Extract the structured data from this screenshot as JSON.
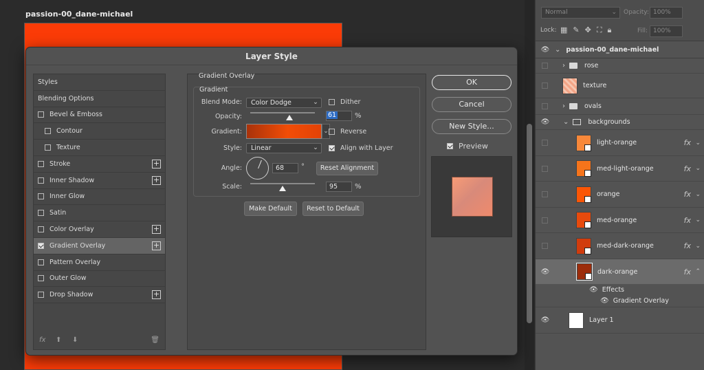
{
  "document": {
    "title": "passion-00_dane-michael",
    "canvas_color": "#fb3b07"
  },
  "layers_panel": {
    "blend_mode": "Normal",
    "opacity_label": "Opacity:",
    "opacity_value": "100%",
    "lock_label": "Lock:",
    "fill_label": "Fill:",
    "fill_value": "100%",
    "group_name": "passion-00_dane-michael",
    "items": [
      {
        "name": "rose",
        "type": "folder"
      },
      {
        "name": "texture",
        "type": "layer"
      },
      {
        "name": "ovals",
        "type": "folder"
      },
      {
        "name": "backgrounds",
        "type": "folder"
      },
      {
        "name": "light-orange",
        "color": "#f8883a"
      },
      {
        "name": "med-light-orange",
        "color": "#f6741b"
      },
      {
        "name": "orange",
        "color": "#fb5606"
      },
      {
        "name": "med-orange",
        "color": "#e84a0c"
      },
      {
        "name": "med-dark-orange",
        "color": "#d13c0d"
      },
      {
        "name": "dark-orange",
        "color": "#9c2c0b"
      },
      {
        "name": "Layer 1",
        "color": "#ffffff"
      }
    ],
    "effects_label": "Effects",
    "effect_item": "Gradient Overlay",
    "fx_label": "fx"
  },
  "dialog": {
    "title": "Layer Style",
    "styles": [
      {
        "label": "Styles"
      },
      {
        "label": "Blending Options"
      },
      {
        "label": "Bevel & Emboss",
        "checkbox": true
      },
      {
        "label": "Contour",
        "checkbox": true,
        "indent": true
      },
      {
        "label": "Texture",
        "checkbox": true,
        "indent": true
      },
      {
        "label": "Stroke",
        "checkbox": true,
        "plus": true
      },
      {
        "label": "Inner Shadow",
        "checkbox": true,
        "plus": true
      },
      {
        "label": "Inner Glow",
        "checkbox": true
      },
      {
        "label": "Satin",
        "checkbox": true
      },
      {
        "label": "Color Overlay",
        "checkbox": true,
        "plus": true
      },
      {
        "label": "Gradient Overlay",
        "checkbox": true,
        "checked": true,
        "plus": true,
        "selected": true
      },
      {
        "label": "Pattern Overlay",
        "checkbox": true
      },
      {
        "label": "Outer Glow",
        "checkbox": true
      },
      {
        "label": "Drop Shadow",
        "checkbox": true,
        "plus": true
      }
    ],
    "bottom": {
      "fx": "fx",
      "up": "⬆",
      "down": "⬇",
      "trash": "🗑"
    },
    "section_title": "Gradient Overlay",
    "group_title": "Gradient",
    "blend_mode_label": "Blend Mode:",
    "blend_mode_value": "Color Dodge",
    "dither_label": "Dither",
    "opacity_label": "Opacity:",
    "opacity_value": "61",
    "opacity_unit": "%",
    "opacity_fraction": 0.61,
    "gradient_label": "Gradient:",
    "reverse_label": "Reverse",
    "style_label": "Style:",
    "style_value": "Linear",
    "align_label": "Align with Layer",
    "angle_label": "Angle:",
    "angle_value": "68",
    "angle_unit": "°",
    "angle_degrees": 68,
    "reset_alignment": "Reset Alignment",
    "scale_label": "Scale:",
    "scale_value": "95",
    "scale_unit": "%",
    "scale_fraction": 0.5,
    "make_default": "Make Default",
    "reset_default": "Reset to Default",
    "ok": "OK",
    "cancel": "Cancel",
    "new_style": "New Style...",
    "preview_label": "Preview"
  }
}
